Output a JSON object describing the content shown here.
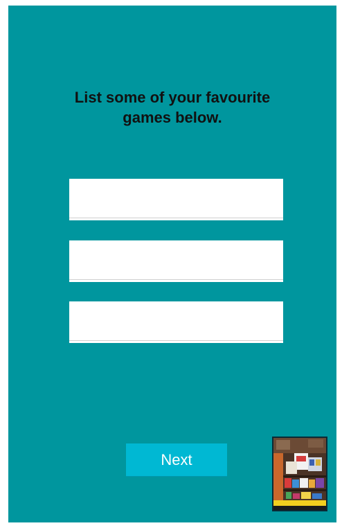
{
  "prompt": {
    "line1": "List some of your favourite",
    "line2": "games below."
  },
  "fields": [
    {
      "value": "",
      "placeholder": ""
    },
    {
      "value": "",
      "placeholder": ""
    },
    {
      "value": "",
      "placeholder": ""
    }
  ],
  "actions": {
    "next_label": "Next"
  },
  "colors": {
    "background": "#00969e",
    "button": "#00b8d3"
  },
  "camera_preview": {
    "icon": "camera-preview-thumbnail"
  }
}
